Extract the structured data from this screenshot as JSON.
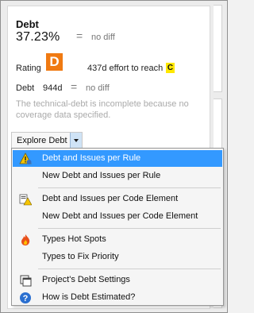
{
  "header": {
    "title": "Debt",
    "percent": "37.23%",
    "eq_symbol": "=",
    "no_diff": "no diff"
  },
  "rating": {
    "label": "Rating",
    "grade": "D",
    "grade_color": "#f07a12",
    "effort_text": "437d effort to reach",
    "target_grade": "C",
    "target_color": "#ffe800"
  },
  "debt_row": {
    "label": "Debt",
    "value": "944d",
    "eq_symbol": "=",
    "no_diff": "no diff"
  },
  "warning": "The technical-debt is incomplete because no coverage data specified.",
  "explore_button": {
    "label": "Explore Debt"
  },
  "menu": {
    "items": [
      {
        "label": "Debt and Issues per Rule",
        "icon": "debt-rule-icon",
        "selected": true
      },
      {
        "label": "New Debt and Issues per Rule",
        "icon": "",
        "selected": false
      },
      {
        "label": "Debt and Issues per Code Element",
        "icon": "code-element-icon",
        "selected": false
      },
      {
        "label": "New Debt and Issues per Code Element",
        "icon": "",
        "selected": false
      },
      {
        "label": "Types Hot Spots",
        "icon": "fire-icon",
        "selected": false
      },
      {
        "label": "Types to Fix Priority",
        "icon": "",
        "selected": false
      },
      {
        "label": "Project's Debt Settings",
        "icon": "settings-window-icon",
        "selected": false
      },
      {
        "label": "How is Debt Estimated?",
        "icon": "help-icon",
        "selected": false
      }
    ]
  }
}
